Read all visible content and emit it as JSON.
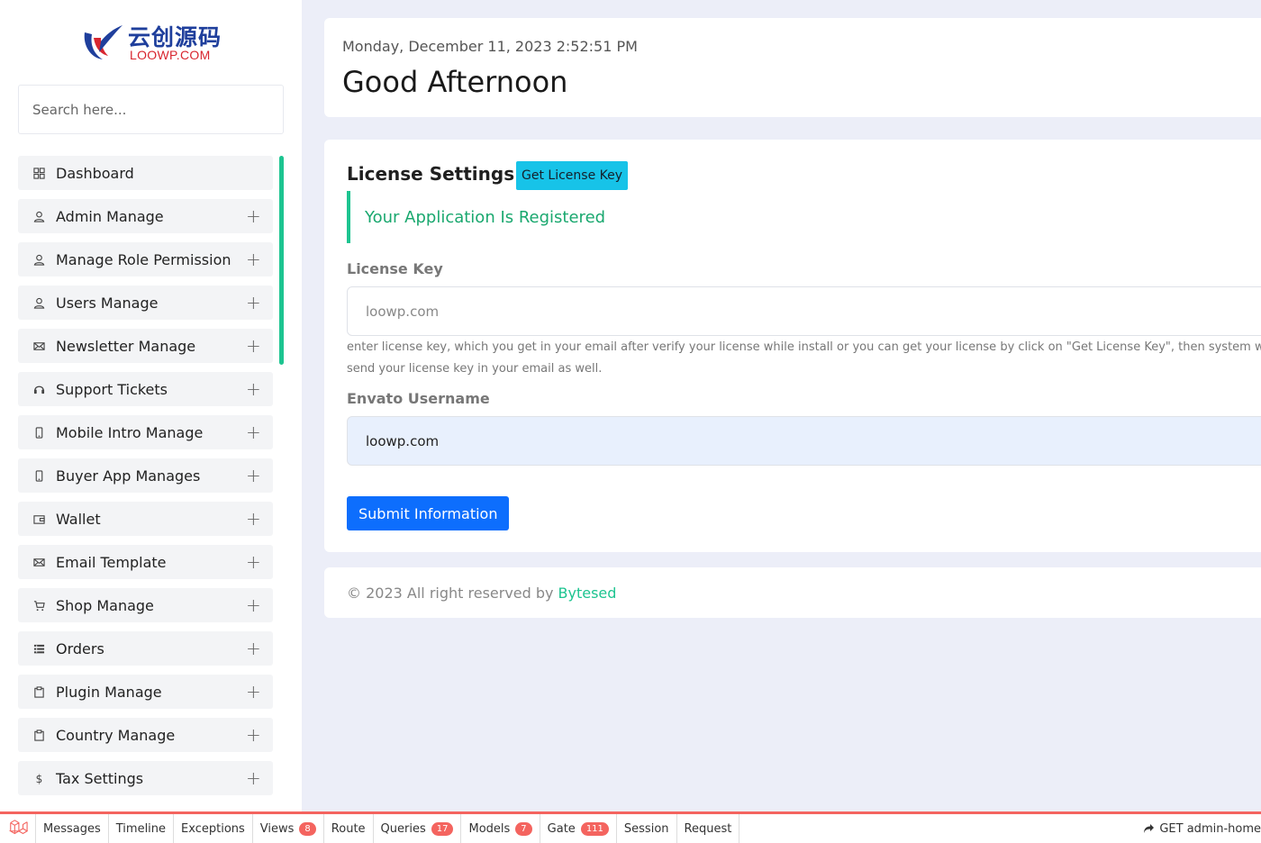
{
  "logo": {
    "cn": "云创源码",
    "en": "LOOWP.COM"
  },
  "search": {
    "placeholder": "Search here..."
  },
  "sidebar": {
    "items": [
      {
        "label": "Dashboard",
        "icon": "grid-icon",
        "expandable": false
      },
      {
        "label": "Admin Manage",
        "icon": "user-icon",
        "expandable": true
      },
      {
        "label": "Manage Role Permission",
        "icon": "user-icon",
        "expandable": true
      },
      {
        "label": "Users Manage",
        "icon": "user-icon",
        "expandable": true
      },
      {
        "label": "Newsletter Manage",
        "icon": "envelope-icon",
        "expandable": true
      },
      {
        "label": "Support Tickets",
        "icon": "headset-icon",
        "expandable": true
      },
      {
        "label": "Mobile Intro Manage",
        "icon": "mobile-icon",
        "expandable": true
      },
      {
        "label": "Buyer App Manages",
        "icon": "mobile-icon",
        "expandable": true
      },
      {
        "label": "Wallet",
        "icon": "wallet-icon",
        "expandable": true
      },
      {
        "label": "Email Template",
        "icon": "envelope-icon",
        "expandable": true
      },
      {
        "label": "Shop Manage",
        "icon": "cart-icon",
        "expandable": true
      },
      {
        "label": "Orders",
        "icon": "list-icon",
        "expandable": true
      },
      {
        "label": "Plugin Manage",
        "icon": "clipboard-icon",
        "expandable": true
      },
      {
        "label": "Country Manage",
        "icon": "clipboard-icon",
        "expandable": true
      },
      {
        "label": "Tax Settings",
        "icon": "dollar-icon",
        "expandable": true
      }
    ]
  },
  "header": {
    "date": "Monday, December 11, 2023 2:52:51 PM",
    "greeting": "Good Afternoon"
  },
  "license": {
    "title": "License Settings",
    "get_key_label": "Get License Key",
    "alert": "Your Application Is Registered",
    "key_label": "License Key",
    "key_placeholder": "loowp.com",
    "help_text": "enter license key, which you get in your email after verify your license while install or you can get your license by click on \"Get License Key\", then system will send your license key in your email as well.",
    "username_label": "Envato Username",
    "username_value": "loowp.com",
    "submit_label": "Submit Information"
  },
  "footer": {
    "text": "© 2023 All right reserved by",
    "brand": "Bytesed"
  },
  "debugbar": {
    "tabs": [
      {
        "label": "Messages"
      },
      {
        "label": "Timeline"
      },
      {
        "label": "Exceptions"
      },
      {
        "label": "Views",
        "badge": "8"
      },
      {
        "label": "Route"
      },
      {
        "label": "Queries",
        "badge": "17"
      },
      {
        "label": "Models",
        "badge": "7"
      },
      {
        "label": "Gate",
        "badge": "111"
      },
      {
        "label": "Session"
      },
      {
        "label": "Request"
      }
    ],
    "route": "GET admin-home"
  },
  "colors": {
    "accent": "#1dc490",
    "primary": "#0d6efd",
    "info": "#17c3e8",
    "debug": "#f4645f"
  }
}
